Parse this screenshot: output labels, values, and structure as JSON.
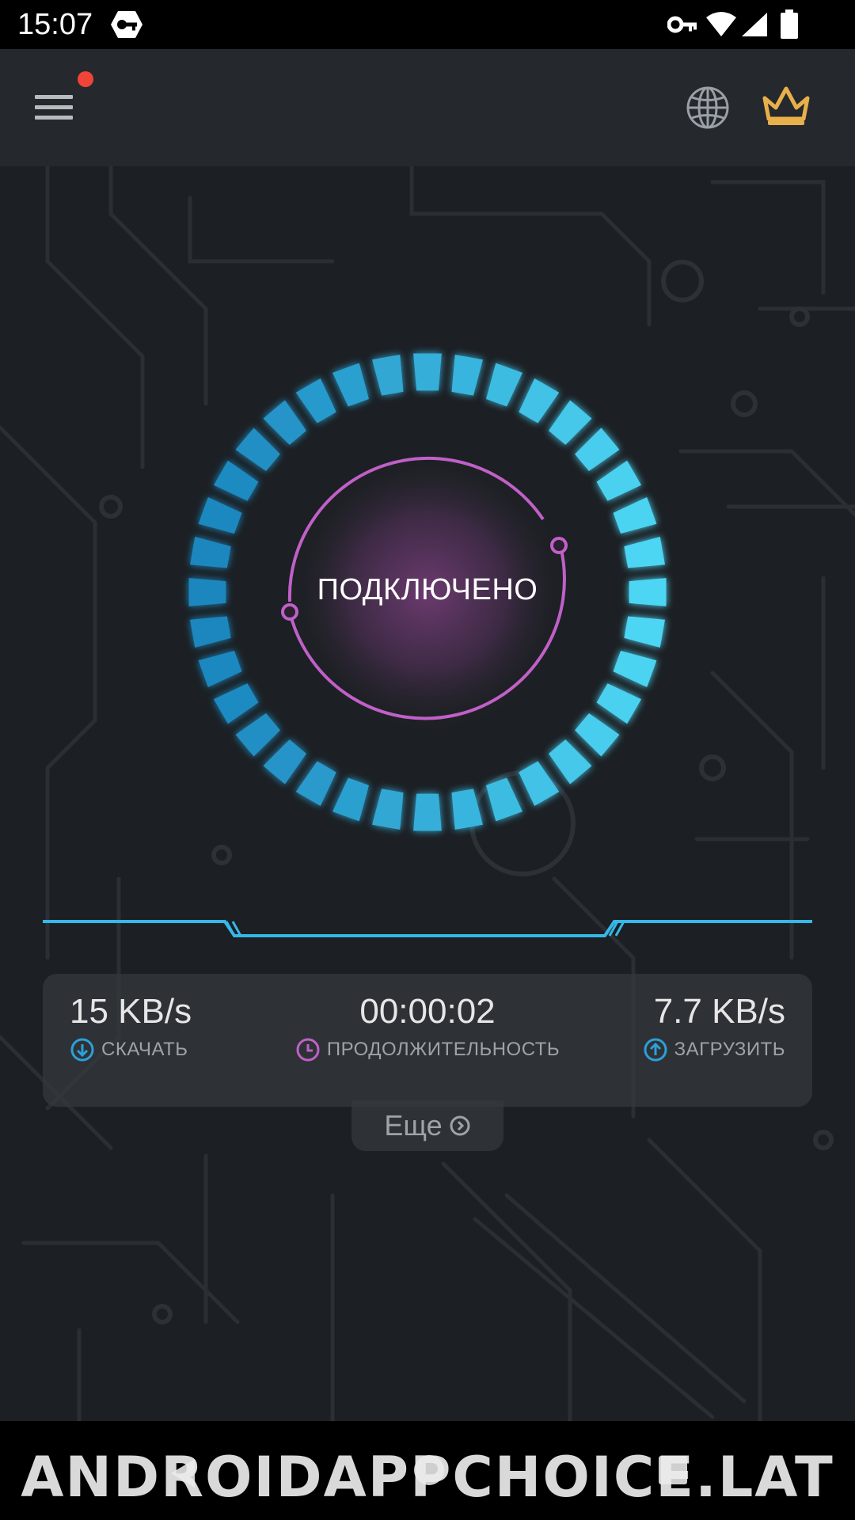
{
  "status_bar": {
    "time": "15:07",
    "icons": [
      "vpn-icon",
      "key-icon",
      "wifi-icon",
      "signal-icon",
      "battery-icon"
    ]
  },
  "app_bar": {
    "menu_icon": "menu-icon",
    "has_notification": true,
    "globe_icon": "globe-icon",
    "crown_icon": "crown-icon"
  },
  "connection": {
    "status": "ПОДКЛЮЧЕНО"
  },
  "stats": {
    "download": {
      "value": "15 KB/s",
      "label": "СКАЧАТЬ",
      "icon": "download-arrow-icon"
    },
    "duration": {
      "value": "00:00:02",
      "label": "ПРОДОЛЖИТЕЛЬНОСТЬ",
      "icon": "clock-icon"
    },
    "upload": {
      "value": "7.7 KB/s",
      "label": "ЗАГРУЗИТЬ",
      "icon": "upload-arrow-icon"
    }
  },
  "more": {
    "label": "Еще",
    "icon": "chevron-right-circle-icon"
  },
  "watermark": "ANDROIDAPPCHOICE.LAT",
  "colors": {
    "accent_blue": "#35b8e8",
    "accent_purple": "#c060c8",
    "download_icon": "#2d9fd8",
    "upload_icon": "#2d9fd8",
    "clock_icon": "#c060c8",
    "crown": "#e8b04a",
    "notification": "#f04438"
  }
}
